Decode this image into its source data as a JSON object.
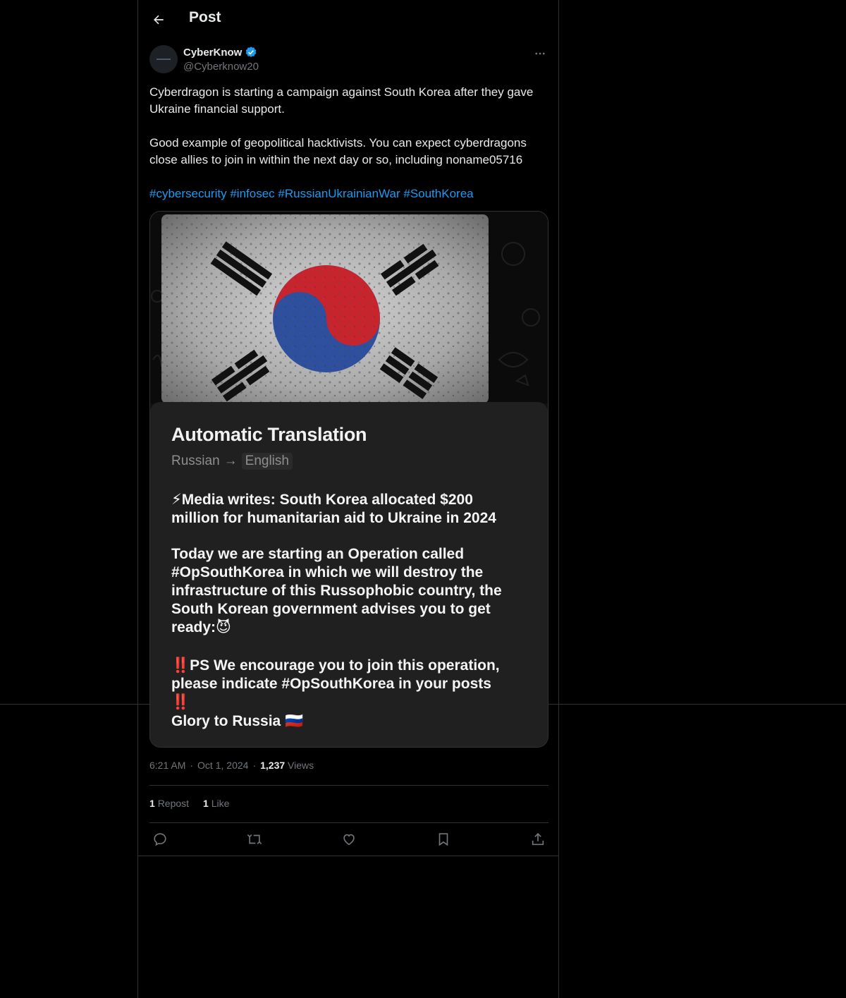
{
  "header": {
    "title": "Post",
    "back_icon": "arrow-left-icon"
  },
  "author": {
    "name": "CyberKnow",
    "handle": "@Cyberknow20",
    "verified": true,
    "verified_color": "#1d9bf0"
  },
  "post": {
    "paragraphs": [
      "Cyberdragon is starting a campaign against South Korea after they gave Ukraine financial support.",
      "Good example of geopolitical hacktivists. You can expect cyberdragons close allies to join in within the next day or so, including noname05716"
    ],
    "hashtags": [
      "#cybersecurity",
      "#infosec",
      "#RussianUkrainianWar",
      "#SouthKorea"
    ],
    "hashtag_color": "#1d9bf0"
  },
  "media": {
    "translation": {
      "title": "Automatic Translation",
      "from": "Russian",
      "arrow": "→",
      "to": "English",
      "p1": "⚡Media writes: South Korea allocated $200 million for humanitarian aid to Ukraine in 2024",
      "p2": "Today we are starting an Operation called #OpSouthKorea in which we will destroy the infrastructure of this Russophobic country, the South Korean government advises you to get ready:😈",
      "p3": "‼️PS We encourage you to join this operation, please indicate #OpSouthKorea in your posts ‼️",
      "p4": "Glory to Russia 🇷🇺"
    }
  },
  "meta": {
    "time": "6:21 AM",
    "sep1": "·",
    "date": "Oct 1, 2024",
    "sep2": "·",
    "views_count": "1,237",
    "views_label": "Views"
  },
  "stats": {
    "reposts_count": "1",
    "reposts_label": "Repost",
    "likes_count": "1",
    "likes_label": "Like"
  },
  "actions": [
    "reply-icon",
    "repost-icon",
    "like-icon",
    "bookmark-icon",
    "share-icon"
  ]
}
